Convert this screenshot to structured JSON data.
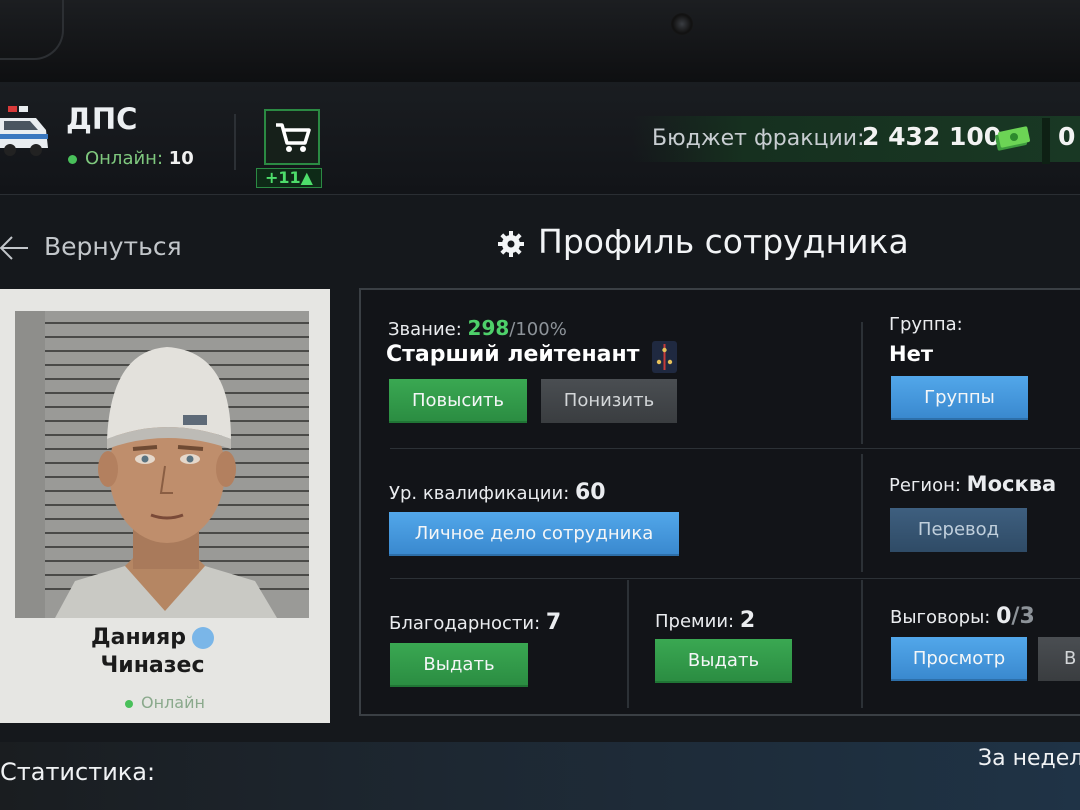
{
  "header": {
    "faction_name": "ДПС",
    "online_label": "Онлайн:",
    "online_count": "10",
    "cart_badge": "+11▲",
    "budget_label": "Бюджет фракции:",
    "budget_value": "2 432 100",
    "budget_extra": "0"
  },
  "nav": {
    "back_label": "Вернуться"
  },
  "page_title": "Профиль сотрудника",
  "employee": {
    "first_name": "Данияр",
    "last_name": "Чиназес",
    "status": "Онлайн"
  },
  "rank": {
    "label": "Звание:",
    "points": "298",
    "max": "/100%",
    "title": "Старший лейтенант",
    "promote_button": "Повысить",
    "demote_button": "Понизить"
  },
  "group": {
    "label": "Группа:",
    "value": "Нет",
    "button": "Группы"
  },
  "qualification": {
    "label": "Ур. квалификации:",
    "value": "60",
    "button": "Личное дело сотрудника"
  },
  "region": {
    "label": "Регион:",
    "value": "Москва",
    "button": "Перевод"
  },
  "thanks": {
    "label": "Благодарности:",
    "value": "7",
    "button": "Выдать"
  },
  "bonuses": {
    "label": "Премии:",
    "value": "2",
    "button": "Выдать"
  },
  "reprimands": {
    "label": "Выговоры:",
    "value": "0",
    "max": "/3",
    "view_button": "Просмотр",
    "issue_button_partial": "В"
  },
  "stats": {
    "label": "Статистика:",
    "period": "За недел"
  },
  "colors": {
    "accent_green": "#4ed06a",
    "button_blue": "#4a98dd",
    "button_green": "#33994a"
  },
  "icons": [
    "police-car-icon",
    "cart-icon",
    "money-icon",
    "back-arrow-icon",
    "gear-icon",
    "rank-insignia-icon",
    "verified-icon"
  ]
}
